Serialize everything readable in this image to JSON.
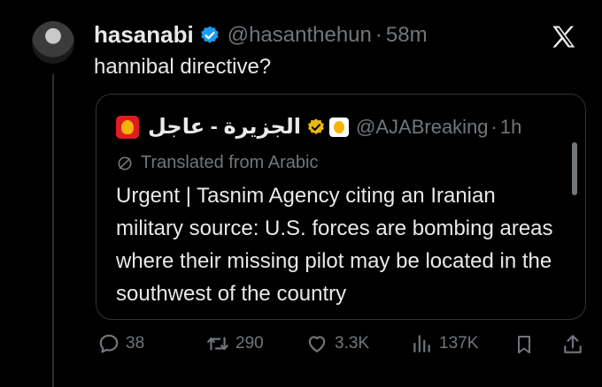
{
  "author": {
    "display_name": "hasanabi",
    "handle": "@hasanthehun",
    "separator": "·",
    "time": "58m",
    "verified_color": "#1d9bf0"
  },
  "tweet": {
    "text": "hannibal directive?"
  },
  "quote": {
    "name": "الجزيرة - عاجل",
    "handle": "@AJABreaking",
    "separator": "·",
    "time": "1h",
    "badge_color": "#e8b711",
    "logo_color": "#e01b22",
    "translated_label": "Translated from Arabic",
    "body": "Urgent | Tasnim Agency citing an Iranian military source: U.S. forces are bombing areas where their missing pilot may be located in the southwest of the country"
  },
  "actions": {
    "replies": "38",
    "reposts": "290",
    "likes": "3.3K",
    "views": "137K"
  },
  "icons": [
    "x-logo-icon",
    "verified-badge-icon",
    "gold-badge-icon",
    "translate-icon",
    "reply-icon",
    "repost-icon",
    "like-icon",
    "views-icon",
    "bookmark-icon",
    "share-icon"
  ]
}
